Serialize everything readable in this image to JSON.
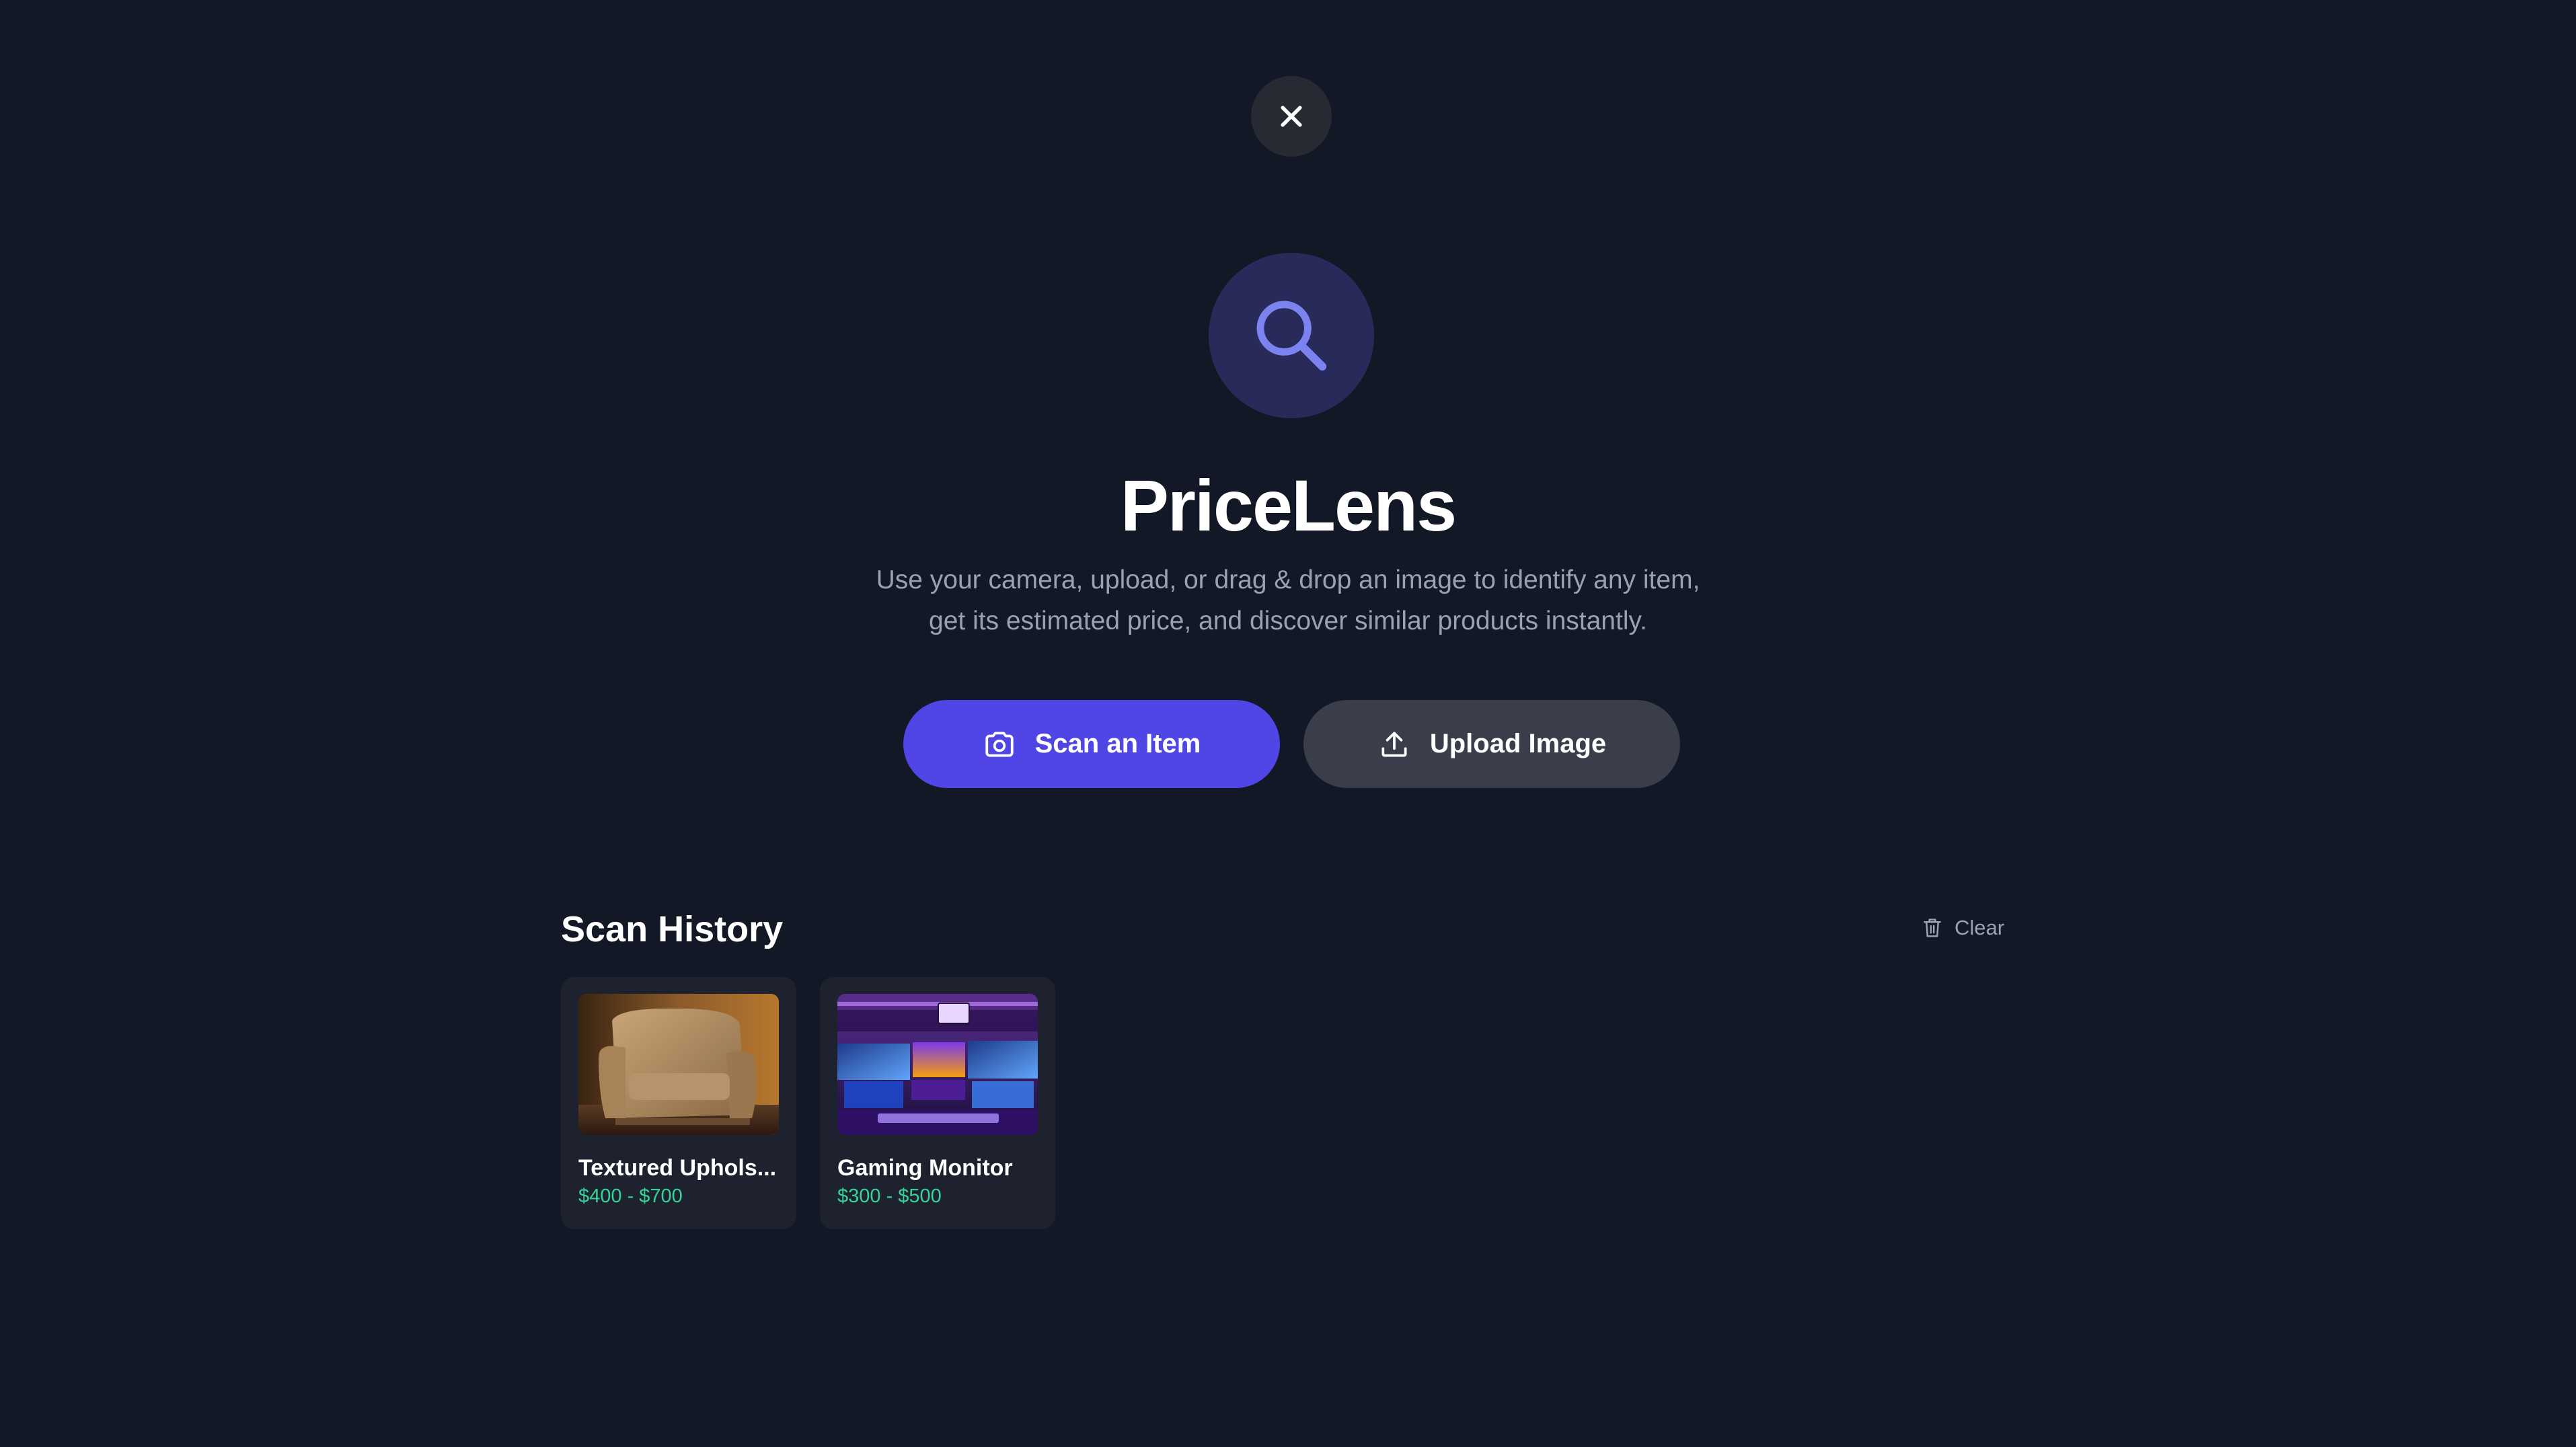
{
  "app": {
    "title": "PriceLens",
    "subtitle_line1": "Use your camera, upload, or drag & drop an image to identify any item,",
    "subtitle_line2": "get its estimated price, and discover similar products instantly."
  },
  "actions": {
    "scan_label": "Scan an Item",
    "upload_label": "Upload Image"
  },
  "history": {
    "title": "Scan History",
    "clear_label": "Clear",
    "items": [
      {
        "name": "Textured Uphols...",
        "price": "$400 - $700"
      },
      {
        "name": "Gaming Monitor",
        "price": "$300 - $500"
      }
    ]
  },
  "icons": {
    "close": "close-icon",
    "hero": "search-icon",
    "scan": "camera-icon",
    "upload": "upload-icon",
    "clear": "trash-icon"
  },
  "colors": {
    "background": "#131826",
    "accent": "#4f46e5",
    "price": "#34d399",
    "hero_icon": "#7c83f0"
  }
}
